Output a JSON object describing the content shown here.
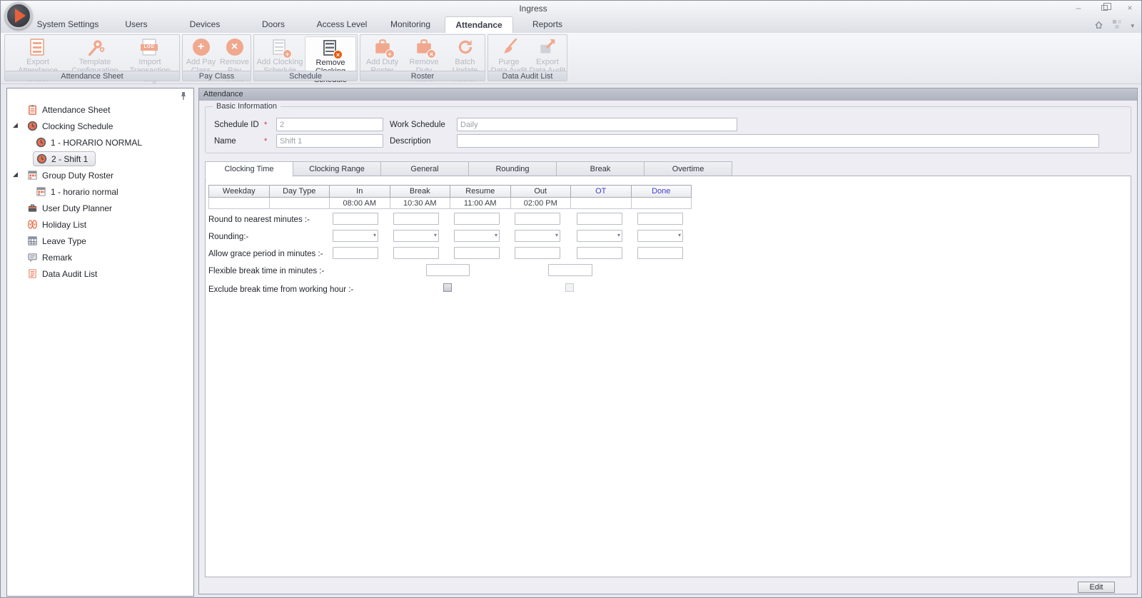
{
  "window": {
    "title": "Ingress"
  },
  "colors": {
    "accent_orange": "#E8633A",
    "disabled_icon_orange": "#F0A88E",
    "tree_icon_orange": "#E8714D",
    "header_blue": "#3B3BD6",
    "required_red": "#C43C3C",
    "panel_header_gray": "#B4B9C3"
  },
  "icons": {
    "add_glyph": "+",
    "remove_glyph": "×",
    "dropdown_glyph": "▾",
    "expander_glyph": "◢",
    "minimize_glyph": "–",
    "close_glyph": "×",
    "log_text": "LOG"
  },
  "ribbon": {
    "tabs": [
      {
        "label": "System Settings"
      },
      {
        "label": "Users"
      },
      {
        "label": "Devices"
      },
      {
        "label": "Doors"
      },
      {
        "label": "Access Level"
      },
      {
        "label": "Monitoring"
      },
      {
        "label": "Attendance",
        "active": true
      },
      {
        "label": "Reports"
      }
    ],
    "groups": [
      {
        "label": "Attendance Sheet",
        "buttons": [
          {
            "label": "Export Attendance Sheet",
            "icon": "attendance-sheet-icon",
            "enabled": false
          },
          {
            "label": "Template Configuration",
            "icon": "template-configuration-icon",
            "enabled": false
          },
          {
            "label": "Import Transaction Log",
            "icon": "import-log-icon",
            "enabled": false
          }
        ]
      },
      {
        "label": "Pay Class",
        "buttons": [
          {
            "label": "Add Pay Class",
            "icon": "add-circle-icon",
            "enabled": false
          },
          {
            "label": "Remove Pay Class",
            "icon": "remove-circle-icon",
            "enabled": false
          }
        ]
      },
      {
        "label": "Schedule",
        "buttons": [
          {
            "label": "Add Clocking Schedule",
            "icon": "add-schedule-icon",
            "enabled": false
          },
          {
            "label": "Remove Clocking Schedule",
            "icon": "remove-schedule-icon",
            "enabled": true
          }
        ]
      },
      {
        "label": "Roster",
        "buttons": [
          {
            "label": "Add Duty Roster",
            "icon": "add-roster-icon",
            "enabled": false
          },
          {
            "label": "Remove Duty Roster",
            "icon": "remove-roster-icon",
            "enabled": false
          },
          {
            "label": "Batch Update Roster",
            "icon": "batch-update-icon",
            "enabled": false
          }
        ]
      },
      {
        "label": "Data Audit List",
        "buttons": [
          {
            "label": "Purge Data Audit",
            "icon": "purge-broom-icon",
            "enabled": false
          },
          {
            "label": "Export Data Audit",
            "icon": "export-arrow-icon",
            "enabled": false
          }
        ]
      }
    ]
  },
  "sidebar": {
    "items": [
      {
        "label": "Attendance Sheet",
        "icon": "clipboard-icon"
      },
      {
        "label": "Clocking Schedule",
        "icon": "clock-icon",
        "expanded": true
      },
      {
        "label": "1 - HORARIO NORMAL",
        "icon": "clock-icon",
        "child": true
      },
      {
        "label": "2 - Shift 1",
        "icon": "clock-icon",
        "child": true,
        "selected": true
      },
      {
        "label": "Group Duty Roster",
        "icon": "roster-grid-icon",
        "expanded": true
      },
      {
        "label": "1 - horario normal",
        "icon": "roster-grid-icon",
        "child": true
      },
      {
        "label": "User Duty Planner",
        "icon": "briefcase-icon"
      },
      {
        "label": "Holiday List",
        "icon": "holiday-icon"
      },
      {
        "label": "Leave Type",
        "icon": "table-icon"
      },
      {
        "label": "Remark",
        "icon": "remark-icon"
      },
      {
        "label": "Data Audit List",
        "icon": "audit-doc-icon"
      }
    ]
  },
  "main": {
    "panel_title": "Attendance",
    "basic_info": {
      "legend": "Basic Information",
      "schedule_id_label": "Schedule ID",
      "schedule_id_required": "*",
      "schedule_id_value": "2",
      "work_schedule_label": "Work Schedule",
      "work_schedule_value": "Daily",
      "name_label": "Name",
      "name_required": "*",
      "name_value": "Shift 1",
      "description_label": "Description",
      "description_value": ""
    },
    "tabs": [
      {
        "label": "Clocking Time",
        "active": true
      },
      {
        "label": "Clocking Range"
      },
      {
        "label": "General"
      },
      {
        "label": "Rounding"
      },
      {
        "label": "Break"
      },
      {
        "label": "Overtime"
      }
    ],
    "clocking_table": {
      "headers": [
        "Weekday",
        "Day Type",
        "In",
        "Break",
        "Resume",
        "Out",
        "OT",
        "Done"
      ],
      "row": [
        "",
        "",
        "08:00 AM",
        "10:30 AM",
        "11:00 AM",
        "02:00 PM",
        "",
        ""
      ]
    },
    "form": {
      "round_label": "Round to nearest minutes :-",
      "rounding_label": "Rounding:-",
      "grace_label": "Allow grace period in minutes :-",
      "flexible_label": "Flexible break time in minutes :-",
      "exclude_label": "Exclude break time from working hour :-"
    },
    "edit_button_label": "Edit"
  }
}
